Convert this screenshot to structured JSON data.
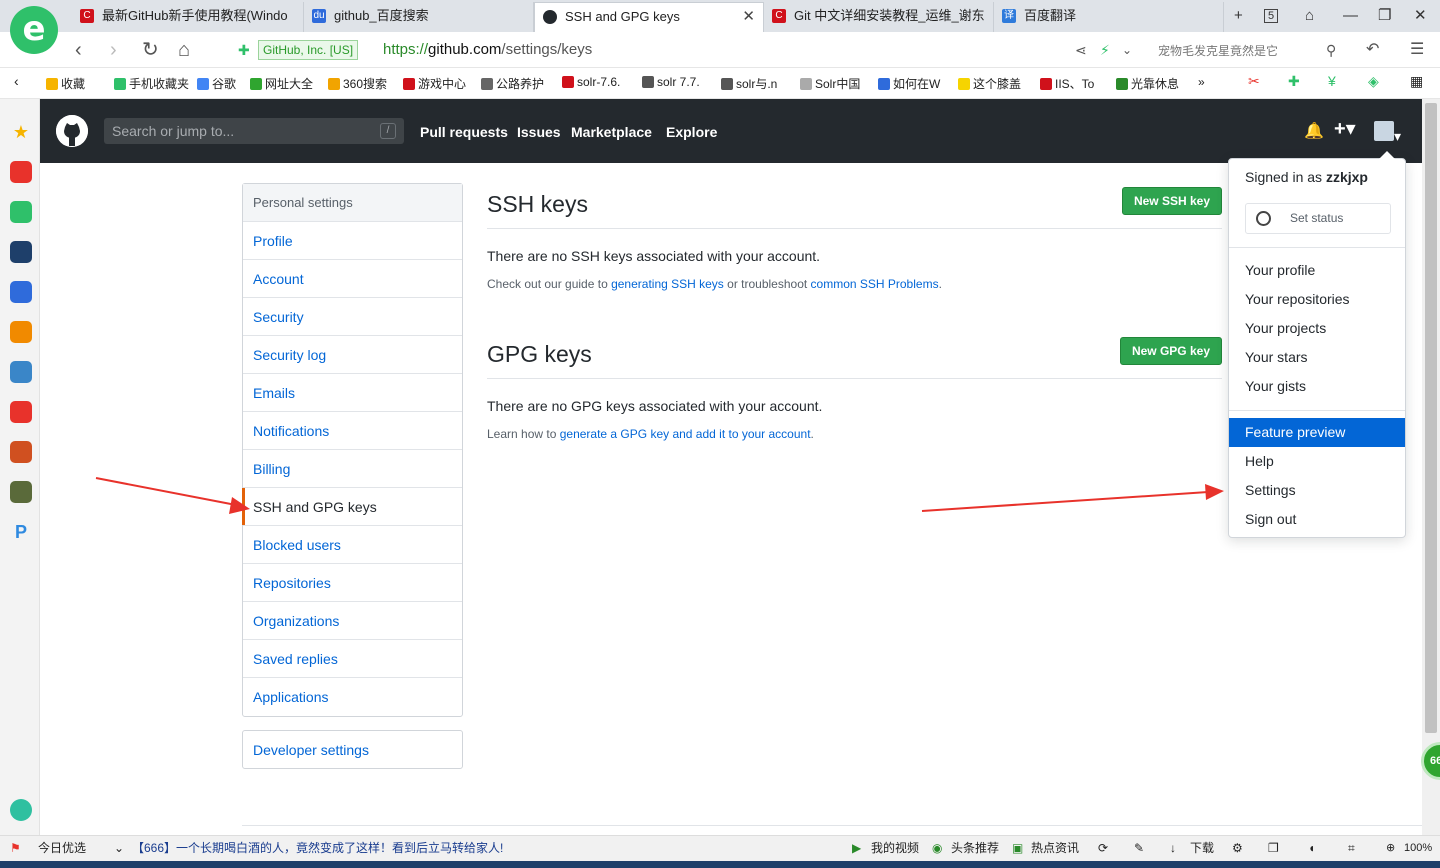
{
  "browser": {
    "tabs": [
      {
        "title": "最新GitHub新手使用教程(Windo",
        "icon_color": "#d0111b"
      },
      {
        "title": "github_百度搜索",
        "icon_color": "#2f6bdb"
      },
      {
        "title": "SSH and GPG keys",
        "icon_color": "#24292e"
      },
      {
        "title": "Git 中文详细安装教程_运维_谢东",
        "icon_color": "#d0111b"
      },
      {
        "title": "百度翻译",
        "icon_color": "#2f7bdb"
      }
    ],
    "tab_count": "5",
    "site_badge": "GitHub, Inc. [US]",
    "url_prefix": "https://",
    "url_host": "github.com",
    "url_path": "/settings/keys",
    "search_box": "宠物毛发克星竟然是它",
    "bookmarks": [
      "收藏",
      "手机收藏夹",
      "谷歌",
      "网址大全",
      "360搜索",
      "游戏中心",
      "公路养护",
      "solr-7.6.",
      "solr 7.7.",
      "solr与.n",
      "Solr中国",
      "如何在W",
      "这个膝盖",
      "IIS、To",
      "光靠休息"
    ]
  },
  "github": {
    "search_placeholder": "Search or jump to...",
    "search_key": "/",
    "nav": [
      "Pull requests",
      "Issues",
      "Marketplace",
      "Explore"
    ]
  },
  "settings_menu": {
    "header": "Personal settings",
    "items": [
      "Profile",
      "Account",
      "Security",
      "Security log",
      "Emails",
      "Notifications",
      "Billing",
      "SSH and GPG keys",
      "Blocked users",
      "Repositories",
      "Organizations",
      "Saved replies",
      "Applications"
    ],
    "selected": "SSH and GPG keys",
    "developer": "Developer settings"
  },
  "ssh": {
    "title": "SSH keys",
    "button": "New SSH key",
    "empty": "There are no SSH keys associated with your account.",
    "help_pre": "Check out our guide to ",
    "help_link1": "generating SSH keys",
    "help_mid": " or troubleshoot ",
    "help_link2": "common SSH Problems",
    "help_end": "."
  },
  "gpg": {
    "title": "GPG keys",
    "button": "New GPG key",
    "empty": "There are no GPG keys associated with your account.",
    "help_pre": "Learn how to ",
    "help_link": "generate a GPG key and add it to your account",
    "help_end": "."
  },
  "user_dropdown": {
    "signed_in_label": "Signed in as ",
    "username": "zzkjxp",
    "set_status": "Set status",
    "group1": [
      "Your profile",
      "Your repositories",
      "Your projects",
      "Your stars",
      "Your gists"
    ],
    "group2": [
      "Feature preview",
      "Help",
      "Settings",
      "Sign out"
    ],
    "highlighted": "Feature preview"
  },
  "statusbar": {
    "left": "今日优选",
    "news": "【666】一个长期喝白酒的人，竟然变成了这样！看到后立马转给家人!",
    "items": [
      "我的视频",
      "头条推荐",
      "热点资讯",
      "下载"
    ],
    "zoom": "100%"
  },
  "badge": "66",
  "colors": {
    "accent_red": "#e8322b",
    "github_header": "#24292e",
    "link": "#0366d6",
    "green_button": "#2ea44f"
  }
}
